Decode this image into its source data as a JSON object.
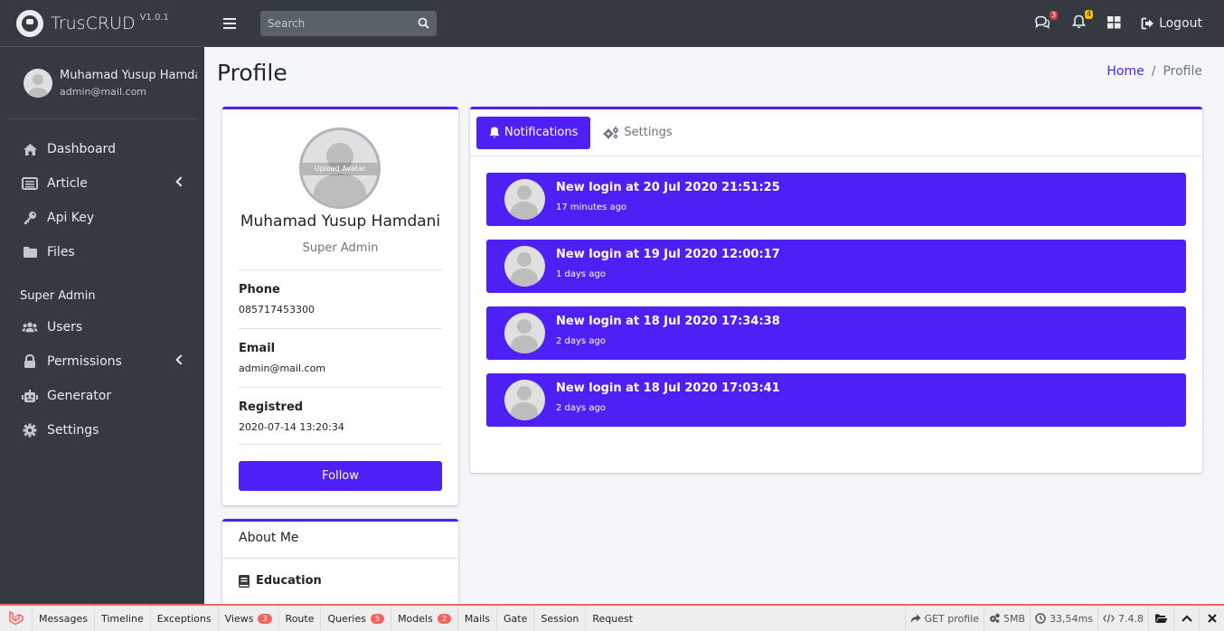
{
  "brand": {
    "name": "TrusCRUD",
    "version": "V1.0.1"
  },
  "user": {
    "name": "Muhamad Yusup Hamda",
    "email": "admin@mail.com"
  },
  "sidebar": {
    "items": [
      {
        "label": "Dashboard",
        "icon": "home-icon"
      },
      {
        "label": "Article",
        "icon": "newspaper-icon"
      },
      {
        "label": "Api Key",
        "icon": "key-icon"
      },
      {
        "label": "Files",
        "icon": "folder-icon"
      }
    ],
    "section_header": "Super Admin",
    "admin_items": [
      {
        "label": "Users",
        "icon": "users-icon"
      },
      {
        "label": "Permissions",
        "icon": "lock-icon"
      },
      {
        "label": "Generator",
        "icon": "robot-icon"
      },
      {
        "label": "Settings",
        "icon": "gear-icon"
      }
    ]
  },
  "topbar": {
    "search_placeholder": "Search",
    "messages_count": "3",
    "notifications_count": "4",
    "logout_label": "Logout"
  },
  "page": {
    "title": "Profile",
    "breadcrumb": [
      "Home",
      "/",
      "Profile"
    ]
  },
  "profile": {
    "upload_label": "Upload Avatar",
    "name": "Muhamad Yusup Hamdani",
    "role": "Super Admin",
    "fields": [
      {
        "label": "Phone",
        "value": "085717453300"
      },
      {
        "label": "Email",
        "value": "admin@mail.com"
      },
      {
        "label": "Registred",
        "value": "2020-07-14 13:20:34"
      }
    ],
    "follow_label": "Follow"
  },
  "about": {
    "title": "About Me",
    "education_label": "Education"
  },
  "tabs": {
    "notifications": "Notifications",
    "settings": "Settings"
  },
  "notifications": [
    {
      "title": "New login at 20 Jul 2020 21:51:25",
      "time": "17 minutes ago"
    },
    {
      "title": "New login at 19 Jul 2020 12:00:17",
      "time": "1 days ago"
    },
    {
      "title": "New login at 18 Jul 2020 17:34:38",
      "time": "2 days ago"
    },
    {
      "title": "New login at 18 Jul 2020 17:03:41",
      "time": "2 days ago"
    }
  ],
  "debugbar": {
    "tabs": [
      "Messages",
      "Timeline",
      "Exceptions",
      "Views",
      "Route",
      "Queries",
      "Models",
      "Mails",
      "Gate",
      "Session",
      "Request"
    ],
    "views_count": "3",
    "queries_count": "5",
    "models_count": "2",
    "route": "GET profile",
    "memory": "5MB",
    "time": "33,54ms",
    "php_version": "7.4.8"
  },
  "colors": {
    "accent": "#4e20f5",
    "sidebar": "#343a40",
    "debug_accent": "#f4645f"
  }
}
